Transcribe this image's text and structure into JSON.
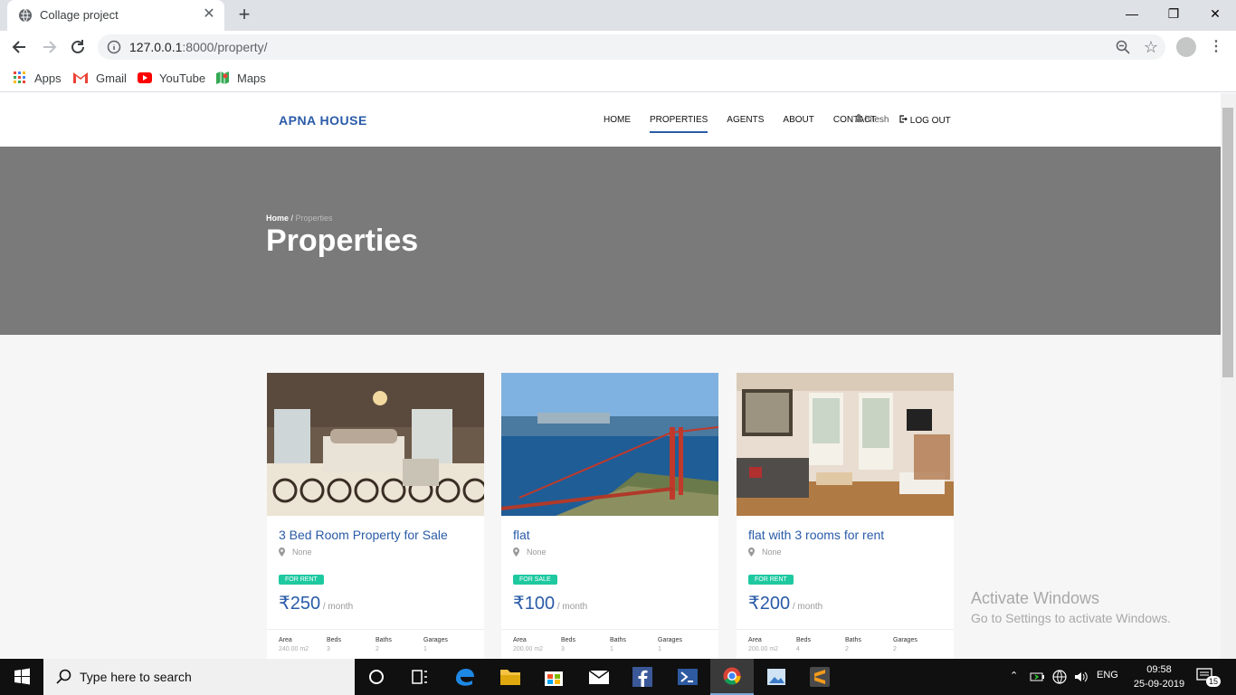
{
  "browser": {
    "tab_title": "Collage project",
    "url_host": "127.0.0.1",
    "url_path": ":8000/property/",
    "bookmarks": [
      {
        "label": "Apps",
        "icon": "apps-grid-icon"
      },
      {
        "label": "Gmail",
        "icon": "gmail-icon"
      },
      {
        "label": "YouTube",
        "icon": "youtube-icon"
      },
      {
        "label": "Maps",
        "icon": "maps-icon"
      }
    ]
  },
  "site": {
    "brand": "APNA HOUSE",
    "menu": [
      "HOME",
      "PROPERTIES",
      "AGENTS",
      "ABOUT",
      "CONTACT"
    ],
    "active_menu": "PROPERTIES",
    "user": "hitesh",
    "logout": "LOG OUT"
  },
  "hero": {
    "crumb_home": "Home",
    "crumb_sep": " / ",
    "crumb_current": "Properties",
    "title": "Properties"
  },
  "stat_labels": {
    "area": "Area",
    "beds": "Beds",
    "baths": "Baths",
    "garages": "Garages"
  },
  "properties": [
    {
      "title": "3 Bed Room Property for Sale",
      "location": "None",
      "badge": "FOR RENT",
      "price": "₹250",
      "per": " / month",
      "area": "240.00 m2",
      "beds": "3",
      "baths": "2",
      "garages": "1",
      "image": "bedroom-photo"
    },
    {
      "title": "flat",
      "location": "None",
      "badge": "FOR SALE",
      "price": "₹100",
      "per": " / month",
      "area": "200.00 m2",
      "beds": "3",
      "baths": "1",
      "garages": "1",
      "image": "bay-bridge-photo"
    },
    {
      "title": "flat with 3 rooms for rent",
      "location": "None",
      "badge": "FOR RENT",
      "price": "₹200",
      "per": " / month",
      "area": "200.00 m2",
      "beds": "4",
      "baths": "2",
      "garages": "2",
      "image": "living-room-photo"
    }
  ],
  "watermark": {
    "heading": "Activate Windows",
    "sub": "Go to Settings to activate Windows."
  },
  "taskbar": {
    "search_placeholder": "Type here to search",
    "lang": "ENG",
    "time": "09:58",
    "date": "25-09-2019",
    "notifications": "15"
  }
}
